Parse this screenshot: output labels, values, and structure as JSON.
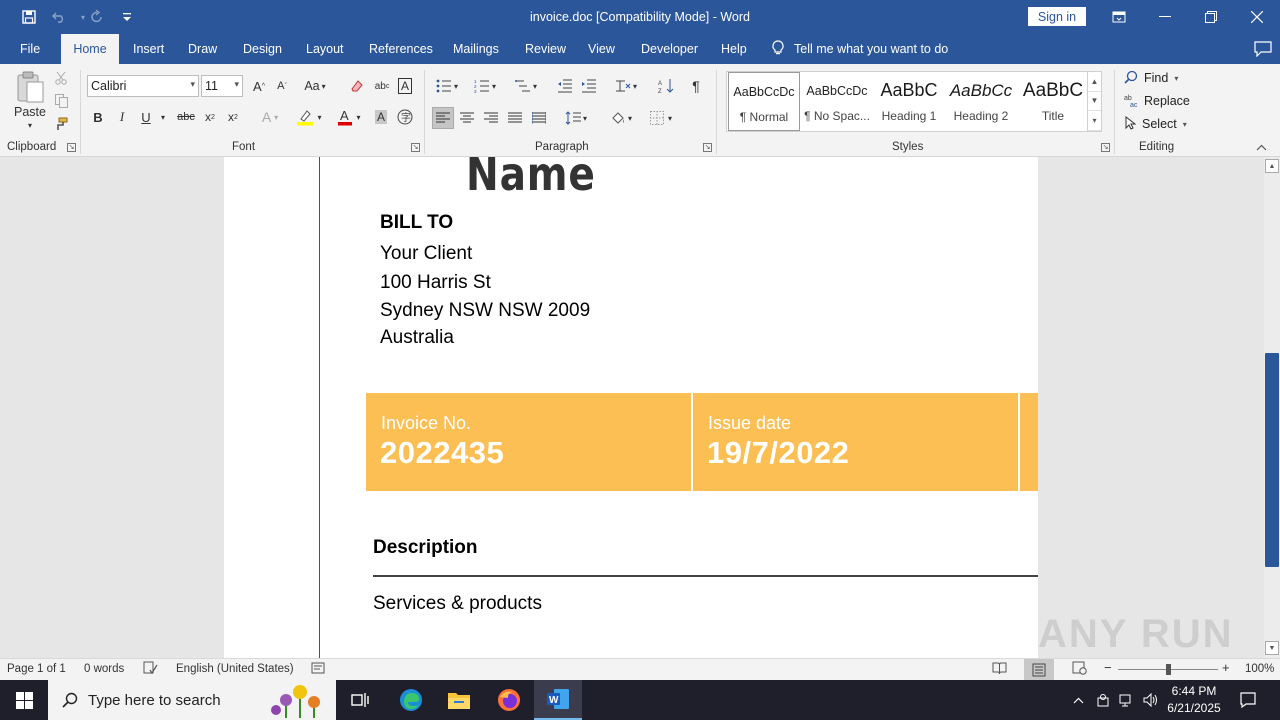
{
  "app": {
    "title": "invoice.doc [Compatibility Mode]  -  Word",
    "sign_in": "Sign in",
    "accent": "#2b579a"
  },
  "qat": {
    "icons": [
      "save-icon",
      "undo-icon",
      "redo-icon",
      "customize-qat-icon"
    ]
  },
  "tabs": [
    "File",
    "Home",
    "Insert",
    "Draw",
    "Design",
    "Layout",
    "References",
    "Mailings",
    "Review",
    "View",
    "Developer",
    "Help"
  ],
  "active_tab": "Home",
  "tell_me": "Tell me what you want to do",
  "ribbon": {
    "clipboard": {
      "label": "Clipboard",
      "paste": "Paste"
    },
    "font": {
      "label": "Font",
      "name": "Calibri",
      "size": "11"
    },
    "paragraph": {
      "label": "Paragraph"
    },
    "styles": {
      "label": "Styles",
      "items": [
        {
          "sample": "AaBbCcDc",
          "name": "¶ Normal"
        },
        {
          "sample": "AaBbCcDc",
          "name": "¶ No Spac..."
        },
        {
          "sample": "AaBbC",
          "name": "Heading 1"
        },
        {
          "sample": "AaBbCc",
          "name": "Heading 2"
        },
        {
          "sample": "AaBbC",
          "name": "Title"
        }
      ]
    },
    "editing": {
      "label": "Editing",
      "find": "Find",
      "replace": "Replace",
      "select": "Select"
    }
  },
  "document": {
    "name_heading": "Name",
    "bill_to": "BILL TO",
    "address": [
      "Your Client",
      "100 Harris St",
      "Sydney NSW NSW 2009",
      "Australia"
    ],
    "band_color": "#fbbf54",
    "invoice_label": "Invoice No.",
    "invoice_value": "2022435",
    "issue_label": "Issue date",
    "issue_value": "19/7/2022",
    "description": "Description",
    "services": "Services & products"
  },
  "status": {
    "page": "Page 1 of 1",
    "words": "0 words",
    "language": "English (United States)",
    "zoom": "100%"
  },
  "taskbar": {
    "search_placeholder": "Type here to search",
    "time": "6:44 PM",
    "date": "6/21/2025"
  },
  "watermark": "ANY RUN"
}
